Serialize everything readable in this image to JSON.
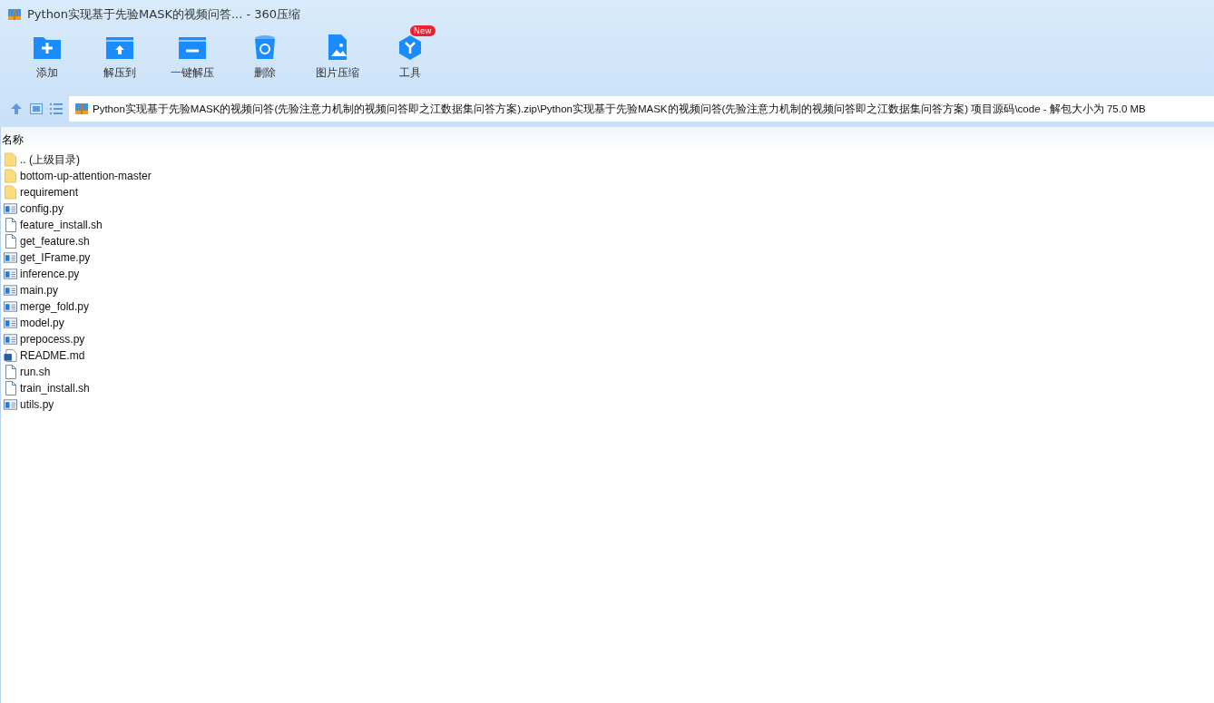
{
  "window": {
    "title": "Python实现基于先验MASK的视频问答... - 360压缩"
  },
  "toolbar": [
    {
      "label": "添加",
      "kind": "add"
    },
    {
      "label": "解压到",
      "kind": "extract"
    },
    {
      "label": "一键解压",
      "kind": "onekey"
    },
    {
      "label": "删除",
      "kind": "delete"
    },
    {
      "label": "图片压缩",
      "kind": "image"
    },
    {
      "label": "工具",
      "kind": "tools",
      "badge": "New"
    }
  ],
  "address": {
    "path": "Python实现基于先验MASK的视频问答(先验注意力机制的视频问答即之江数据集问答方案).zip\\Python实现基于先验MASK的视频问答(先验注意力机制的视频问答即之江数据集问答方案) 项目源码\\code - 解包大小为 75.0 MB"
  },
  "table": {
    "columns": [
      "名称"
    ],
    "rows": [
      {
        "name": ".. (上级目录)",
        "kind": "folder"
      },
      {
        "name": "bottom-up-attention-master",
        "kind": "folder"
      },
      {
        "name": "requirement",
        "kind": "folder"
      },
      {
        "name": "config.py",
        "kind": "py"
      },
      {
        "name": "feature_install.sh",
        "kind": "file"
      },
      {
        "name": "get_feature.sh",
        "kind": "file"
      },
      {
        "name": "get_IFrame.py",
        "kind": "py"
      },
      {
        "name": "inference.py",
        "kind": "py"
      },
      {
        "name": "main.py",
        "kind": "py"
      },
      {
        "name": "merge_fold.py",
        "kind": "py"
      },
      {
        "name": "model.py",
        "kind": "py"
      },
      {
        "name": "prepocess.py",
        "kind": "py"
      },
      {
        "name": "README.md",
        "kind": "md"
      },
      {
        "name": "run.sh",
        "kind": "file"
      },
      {
        "name": "train_install.sh",
        "kind": "file"
      },
      {
        "name": "utils.py",
        "kind": "py"
      }
    ]
  }
}
